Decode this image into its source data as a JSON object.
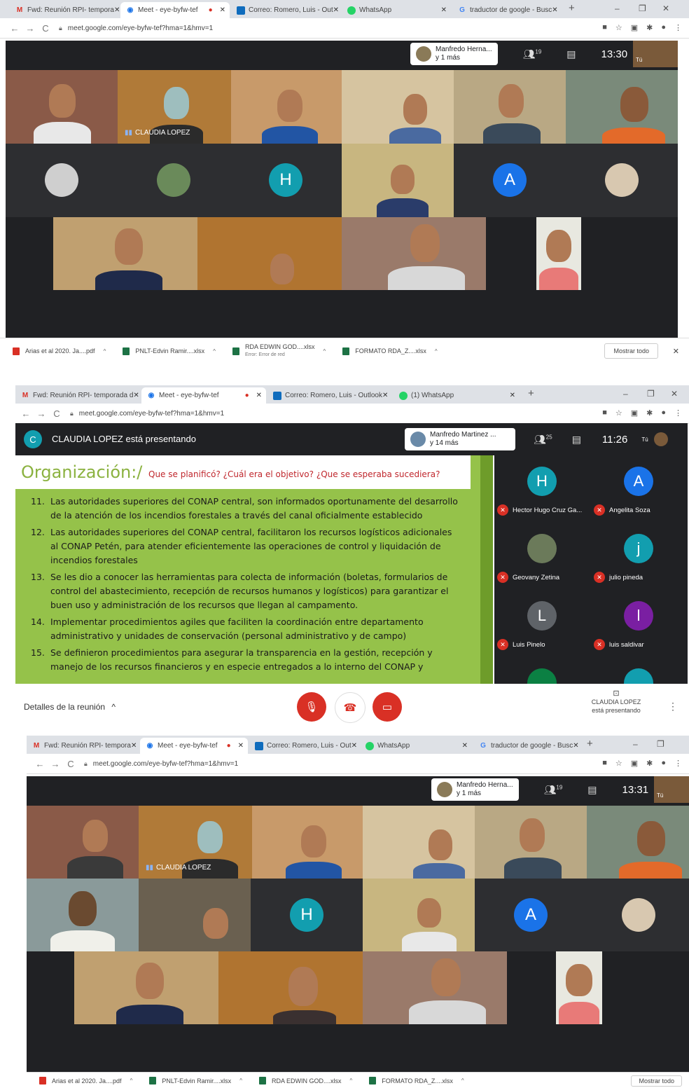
{
  "colors": {
    "meet_bg": "#202124",
    "mic_off_red": "#d93025",
    "avatar_teal": "#129eaf",
    "avatar_blue": "#1a73e8",
    "avatar_purple": "#7a1fa2",
    "avatar_gray": "#5f6368",
    "avatar_green": "#0b8043",
    "slide_green": "#95c24a"
  },
  "shot1": {
    "tabs": [
      "Fwd: Reunión RPI- tempora",
      "Meet - eye-byfw-tef",
      "Correo: Romero, Luis - Out",
      "WhatsApp",
      "traductor de google - Busc"
    ],
    "url": "meet.google.com/eye-byfw-tef?hma=1&hmv=1",
    "presenter": "Manfredo Herna...",
    "presenter_more": "y 1 más",
    "participants_count": "19",
    "clock": "13:30",
    "you_label": "Tú",
    "tile_name": "CLAUDIA LOPEZ",
    "avatars": [
      "H",
      "A"
    ],
    "downloads": [
      {
        "name": "Arias et al 2020. Ja....pdf",
        "sub": ""
      },
      {
        "name": "PNLT-Edvin Ramir....xlsx",
        "sub": ""
      },
      {
        "name": "RDA EDWIN GOD....xlsx",
        "sub": "Error: Error de red"
      },
      {
        "name": "FORMATO RDA_Z....xlsx",
        "sub": ""
      }
    ],
    "show_all": "Mostrar todo"
  },
  "shot2": {
    "tabs": [
      "Fwd: Reunión RPI- temporada d",
      "Meet - eye-byfw-tef",
      "Correo: Romero, Luis - Outlook",
      "(1) WhatsApp"
    ],
    "url": "meet.google.com/eye-byfw-tef?hma=1&hmv=1",
    "presenting_avatar": "C",
    "presenting_banner": "CLAUDIA LOPEZ está presentando",
    "presenter": "Manfredo Martinez ...",
    "presenter_more": "y 14 más",
    "participants_count": "25",
    "clock": "11:26",
    "you_label": "Tú",
    "slide": {
      "title": "Organización:/",
      "questions": "Que se planificó? ¿Cuál era el objetivo? ¿Que se esperaba sucediera?",
      "items": [
        {
          "num": "11.",
          "text": "Las autoridades superiores del CONAP central, son informados oportunamente del desarrollo de la atención de los incendios forestales a través del canal oficialmente establecido"
        },
        {
          "num": "12.",
          "text": "Las autoridades superiores del CONAP central, facilitaron los recursos logísticos adicionales al CONAP Petén, para atender eficientemente las operaciones de control y liquidación de incendios forestales"
        },
        {
          "num": "13.",
          "text": "Se les dio a conocer las herramientas para colecta de información (boletas, formularios de control del abastecimiento, recepción de recursos humanos y logísticos) para garantizar el buen uso y administración de los recursos que llegan al campamento."
        },
        {
          "num": "14.",
          "text": "Implementar procedimientos agiles que faciliten la coordinación entre departamento administrativo y unidades de conservación (personal administrativo y de campo)"
        },
        {
          "num": "15.",
          "text": "Se definieron procedimientos para asegurar la transparencia en la gestión, recepción y manejo de los recursos financieros y en especie entregados a lo interno del CONAP y"
        }
      ]
    },
    "participants": [
      {
        "initial": "H",
        "name": "Hector Hugo Cruz Ga...",
        "color": "#129eaf"
      },
      {
        "initial": "A",
        "name": "Angelita Soza",
        "color": "#1a73e8"
      },
      {
        "initial": "",
        "name": "Geovany Zetina",
        "color": "#6b7a5a"
      },
      {
        "initial": "j",
        "name": "julio pineda",
        "color": "#129eaf"
      },
      {
        "initial": "L",
        "name": "Luis Pinelo",
        "color": "#5f6368"
      },
      {
        "initial": "l",
        "name": "luis saldivar",
        "color": "#7a1fa2"
      }
    ],
    "meeting_details": "Detalles de la reunión",
    "presenting_line1": "CLAUDIA LOPEZ",
    "presenting_line2": "está presentando"
  },
  "shot3": {
    "tabs": [
      "Fwd: Reunión RPI- tempora",
      "Meet - eye-byfw-tef",
      "Correo: Romero, Luis - Out",
      "WhatsApp",
      "traductor de google - Busc"
    ],
    "url": "meet.google.com/eye-byfw-tef?hma=1&hmv=1",
    "presenter": "Manfredo Herna...",
    "presenter_more": "y 1 más",
    "participants_count": "19",
    "clock": "13:31",
    "you_label": "Tú",
    "tile_name": "CLAUDIA LOPEZ",
    "avatars": [
      "H",
      "A"
    ],
    "downloads": [
      {
        "name": "Arias et al 2020. Ja....pdf"
      },
      {
        "name": "PNLT-Edvin Ramir....xlsx"
      },
      {
        "name": "RDA EDWIN GOD....xlsx"
      },
      {
        "name": "FORMATO RDA_Z....xlsx"
      }
    ],
    "show_all": "Mostrar todo"
  }
}
